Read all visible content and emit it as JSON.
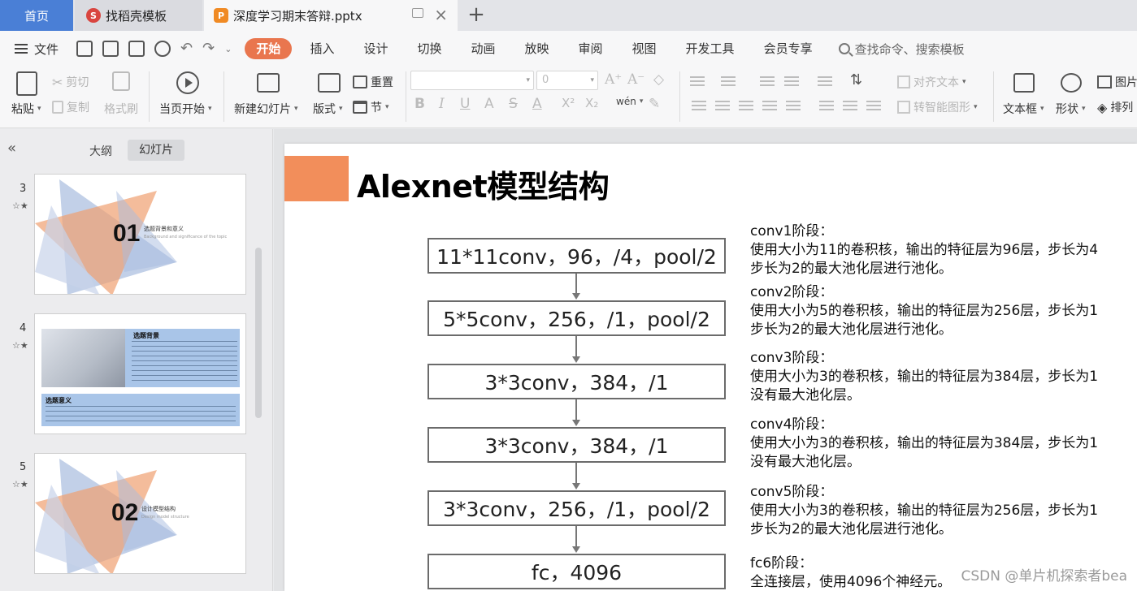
{
  "tabs": {
    "home": "首页",
    "template": "找稻壳模板",
    "file": "深度学习期末答辩.pptx"
  },
  "menu": {
    "file_label": "文件",
    "tabs": [
      "开始",
      "插入",
      "设计",
      "切换",
      "动画",
      "放映",
      "审阅",
      "视图",
      "开发工具",
      "会员专享"
    ],
    "search_placeholder": "查找命令、搜索模板"
  },
  "ribbon": {
    "paste": "粘贴",
    "cut": "剪切",
    "copy": "复制",
    "format_painter": "格式刷",
    "from_current": "当页开始",
    "new_slide": "新建幻灯片",
    "layout": "版式",
    "reset": "重置",
    "section": "节",
    "font_size_value": "0",
    "phonetic": "wén",
    "align_text": "对齐文本",
    "smart_graphic": "转智能图形",
    "textbox": "文本框",
    "shape": "形状",
    "picture": "图片",
    "arrange": "排列"
  },
  "panel": {
    "outline_tab": "大纲",
    "slides_tab": "幻灯片",
    "slides": [
      {
        "number": "3",
        "big": "01",
        "title": "选题背景和意义",
        "subtitle": "Background and significance of the topic"
      },
      {
        "number": "4",
        "head1": "选题背景",
        "head2": "选题意义"
      },
      {
        "number": "5",
        "big": "02",
        "title": "设计模型结构",
        "subtitle": "Design model structure"
      }
    ]
  },
  "slide": {
    "title": "Alexnet模型结构",
    "layers": [
      "11*11conv，96，/4，pool/2",
      "5*5conv，256，/1，pool/2",
      "3*3conv，384，/1",
      "3*3conv，384，/1",
      "3*3conv，256，/1，pool/2",
      "fc，4096"
    ],
    "descriptions": [
      {
        "stage": "conv1阶段：",
        "line1": "使用大小为11的卷积核，输出的特征层为96层，步长为4",
        "line2": "步长为2的最大池化层进行池化。"
      },
      {
        "stage": "conv2阶段：",
        "line1": "使用大小为5的卷积核，输出的特征层为256层，步长为1",
        "line2": "步长为2的最大池化层进行池化。"
      },
      {
        "stage": "conv3阶段：",
        "line1": "使用大小为3的卷积核，输出的特征层为384层，步长为1",
        "line2": "没有最大池化层。"
      },
      {
        "stage": "conv4阶段：",
        "line1": "使用大小为3的卷积核，输出的特征层为384层，步长为1",
        "line2": "没有最大池化层。"
      },
      {
        "stage": "conv5阶段：",
        "line1": "使用大小为3的卷积核，输出的特征层为256层，步长为1",
        "line2": "步长为2的最大池化层进行池化。"
      },
      {
        "stage": "fc6阶段：",
        "line1": "全连接层，使用4096个神经元。",
        "line2": ""
      }
    ]
  },
  "watermark": "CSDN @单片机探索者bea",
  "colors": {
    "accent": "#f28e5b",
    "active_tab": "#e9764e",
    "home_tab": "#4a7fd6"
  }
}
